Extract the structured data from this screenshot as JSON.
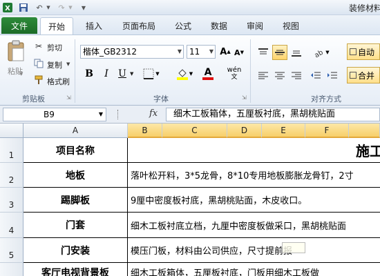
{
  "app": {
    "title": "装修材料",
    "quick_access": [
      "excel-logo-icon",
      "save-icon",
      "undo-icon",
      "redo-icon",
      "customize-arrow-icon"
    ]
  },
  "tabs": {
    "file": "文件",
    "items": [
      "开始",
      "插入",
      "页面布局",
      "公式",
      "数据",
      "审阅",
      "视图"
    ],
    "active": "开始"
  },
  "ribbon": {
    "clipboard": {
      "paste": "粘贴",
      "cut": "剪切",
      "copy": "复制",
      "format_painter": "格式刷",
      "label": "剪贴板"
    },
    "font": {
      "name": "楷体_GB2312",
      "size": "11",
      "bold": "B",
      "italic": "I",
      "underline": "U",
      "font_color_glyph": "A",
      "label": "字体",
      "grow": "A",
      "shrink": "A",
      "phonetic": "wén"
    },
    "alignment": {
      "wrap": "自动",
      "merge": "合并",
      "label": "对齐方式"
    }
  },
  "formula_bar": {
    "name_box": "B9",
    "fx": "fx",
    "content": "细木工板箱体，五厘板衬底，黑胡桃贴面"
  },
  "grid": {
    "columns": [
      "A",
      "B",
      "C",
      "D",
      "E",
      "F"
    ],
    "rows": [
      {
        "num": "1",
        "a": "项目名称",
        "b": "施工"
      },
      {
        "num": "2",
        "a": "地板",
        "b": "落叶松开料，3*5龙骨，8*10专用地板膨胀龙骨钉，2寸"
      },
      {
        "num": "3",
        "a": "踢脚板",
        "b": "9厘中密度板衬底，黑胡桃贴面，木皮收口。"
      },
      {
        "num": "4",
        "a": "门套",
        "b": "细木工板衬底立档，九厘中密度板做采口，黑胡桃贴面"
      },
      {
        "num": "5",
        "a": "门安装",
        "b": "模压门板，材料由公司供应，尺寸提前报"
      },
      {
        "num": "6",
        "a": "客厅电视背景板",
        "b": "细木工板箱体，五厘板衬底，门板用细木工板做"
      }
    ]
  }
}
